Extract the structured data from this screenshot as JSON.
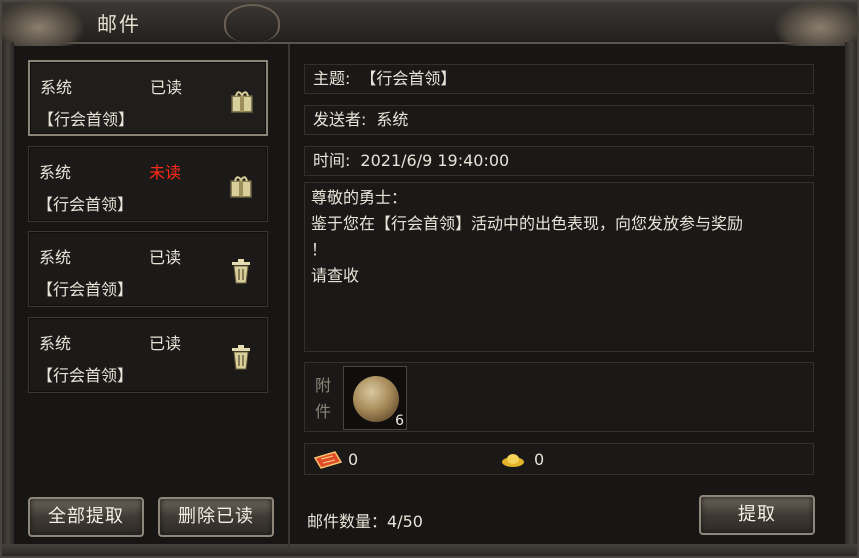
{
  "window": {
    "title": "邮件"
  },
  "mails": [
    {
      "sender": "系统",
      "status": "已读",
      "subject": "【行会首领】",
      "icon": "gift-box-icon",
      "selected": true
    },
    {
      "sender": "系统",
      "status": "未读",
      "subject": "【行会首领】",
      "icon": "gift-box-icon",
      "selected": false
    },
    {
      "sender": "系统",
      "status": "已读",
      "subject": "【行会首领】",
      "icon": "trash-icon",
      "selected": false
    },
    {
      "sender": "系统",
      "status": "已读",
      "subject": "【行会首领】",
      "icon": "trash-icon",
      "selected": false
    }
  ],
  "buttons": {
    "claim_all": "全部提取",
    "delete_read": "删除已读",
    "claim": "提取"
  },
  "detail": {
    "subject_label": "主题:",
    "subject": "【行会首领】",
    "sender_label": "发送者:",
    "sender": "系统",
    "time_label": "时间:",
    "time": "2021/6/9 19:40:00",
    "body": [
      "尊敬的勇士：",
      "鉴于您在【行会首领】活动中的出色表现，向您发放参与奖励",
      "！",
      "请查收"
    ],
    "attachment_label": "附件",
    "attachment": {
      "icon": "gold-orb-icon",
      "count": "6"
    },
    "currencies": [
      {
        "icon": "red-ticket-icon",
        "value": "0"
      },
      {
        "icon": "gold-ingot-icon",
        "value": "0"
      }
    ]
  },
  "footer": {
    "mail_count_label": "邮件数量：",
    "mail_count": "4/50"
  },
  "colors": {
    "unread": "#ff2a1a",
    "text": "#e8e2d8",
    "panel": "#1b1917"
  }
}
